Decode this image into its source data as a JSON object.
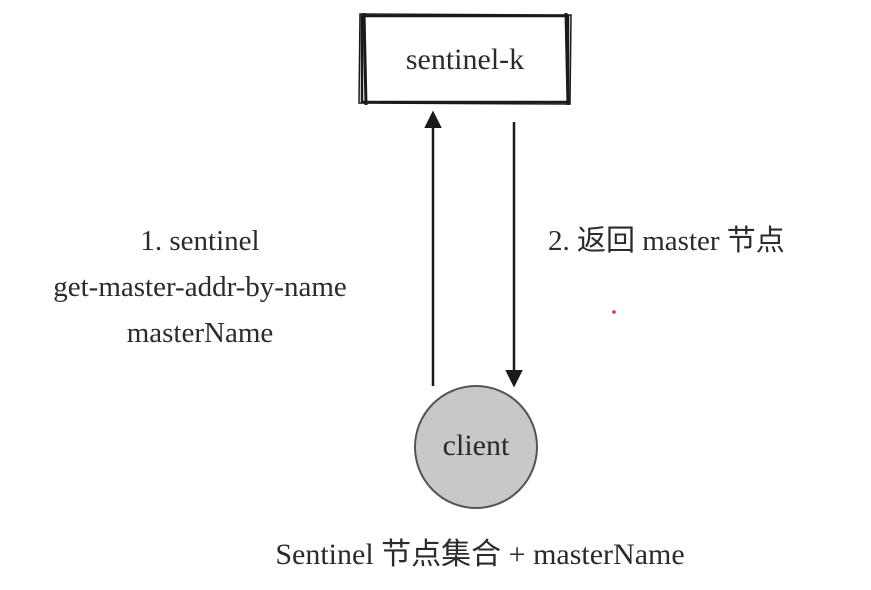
{
  "sentinel_box": {
    "label": "sentinel-k"
  },
  "client_node": {
    "label": "client",
    "fill_color": "#c8c8c8",
    "stroke_color": "#555555"
  },
  "request": {
    "line1": "1. sentinel",
    "line2": "get-master-addr-by-name",
    "line3": "masterName"
  },
  "response": {
    "label": "2. 返回 master 节点"
  },
  "caption": {
    "text": "Sentinel 节点集合 + masterName"
  },
  "colors": {
    "ink": "#1a1a1a",
    "text": "#2b2b2b",
    "marker": "#e0313a"
  }
}
